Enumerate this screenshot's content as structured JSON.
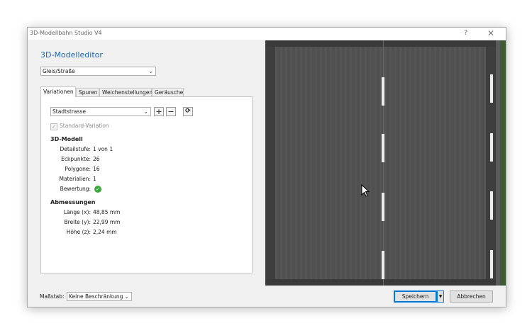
{
  "window": {
    "title": "3D-Modellbahn Studio V4",
    "help_glyph": "?",
    "close_glyph": "✕"
  },
  "editor": {
    "heading": "3D-Modelleditor",
    "category_value": "Gleis/Straße"
  },
  "tabs": [
    {
      "label": "Variationen",
      "active": true
    },
    {
      "label": "Spuren",
      "active": false
    },
    {
      "label": "Weichenstellungen",
      "active": false
    },
    {
      "label": "Geräusche",
      "active": false
    }
  ],
  "variations": {
    "selected": "Stadtstrasse",
    "add_glyph": "+",
    "remove_glyph": "−",
    "refresh_glyph": "⟳",
    "standard_label": "Standard-Variation",
    "standard_checked": true
  },
  "model3d": {
    "title": "3D-Modell",
    "rows": [
      {
        "label": "Detailstufe:",
        "value": "1 von 1"
      },
      {
        "label": "Eckpunkte:",
        "value": "26"
      },
      {
        "label": "Polygone:",
        "value": "16"
      },
      {
        "label": "Materialien:",
        "value": "1"
      },
      {
        "label": "Bewertung:",
        "value": "",
        "icon": "check-circle-icon"
      }
    ]
  },
  "dimensions": {
    "title": "Abmessungen",
    "rows": [
      {
        "label": "Länge (x):",
        "value": "48,85 mm"
      },
      {
        "label": "Breite (y):",
        "value": "22,99 mm"
      },
      {
        "label": "Höhe (z):",
        "value": "2,24 mm"
      }
    ]
  },
  "footer": {
    "scale_label": "Maßstab:",
    "scale_value": "Keine Beschränkung",
    "save_label": "Speichern",
    "cancel_label": "Abbrechen"
  },
  "colors": {
    "accent": "#1c65b0",
    "road": "#525252",
    "road_marking": "#ececec",
    "rating_ok": "#3caa3c"
  }
}
